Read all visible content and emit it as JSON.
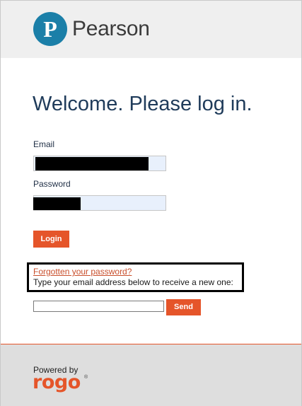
{
  "header": {
    "brand_name": "Pearson",
    "logo_glyph": "P",
    "brand_color": "#1b7fa8"
  },
  "login": {
    "title": "Welcome. Please log in.",
    "email_label": "Email",
    "password_label": "Password",
    "login_button": "Login"
  },
  "reset": {
    "link_text": "Forgotten your password?",
    "instructions": "Type your email address below to receive a new one:",
    "email_value": "",
    "send_button": "Send"
  },
  "footer": {
    "powered_by": "Powered by",
    "product_name": "rogo",
    "registered_mark": "®",
    "accent_color": "#e5552a"
  }
}
